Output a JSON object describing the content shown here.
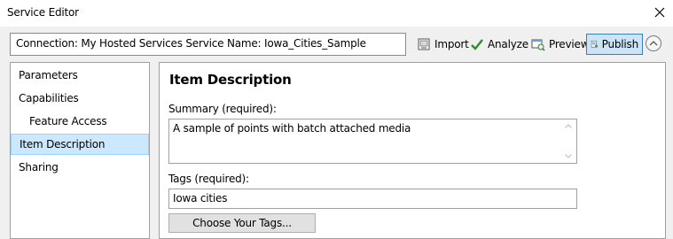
{
  "window": {
    "title": "Service Editor",
    "close_icon": "close-icon"
  },
  "connection": {
    "text": "Connection: My Hosted Services   Service Name: Iowa_Cities_Sample"
  },
  "toolbar": {
    "import_label": "Import",
    "analyze_label": "Analyze",
    "preview_label": "Preview",
    "publish_label": "Publish",
    "collapse_icon": "chevron-up-icon",
    "accent": "#cce4f7",
    "check_color": "#2e8b2e"
  },
  "sidebar": {
    "items": [
      {
        "label": "Parameters"
      },
      {
        "label": "Capabilities"
      },
      {
        "label": "Feature Access"
      },
      {
        "label": "Item Description"
      },
      {
        "label": "Sharing"
      }
    ],
    "selected": "Item Description",
    "selected_color": "#cce8ff"
  },
  "main": {
    "heading": "Item Description",
    "summary_label": "Summary (required):",
    "summary_value": "A sample of points with batch attached media",
    "tags_label": "Tags (required):",
    "tags_value": "Iowa cities",
    "choose_tags_label": "Choose Your Tags..."
  }
}
